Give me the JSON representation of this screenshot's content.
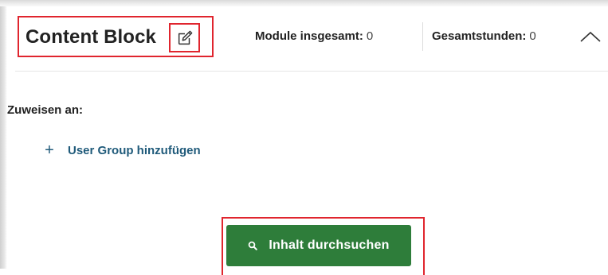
{
  "block": {
    "title": "Content Block",
    "edit_icon": "pencil-edit-icon",
    "modules_label": "Module insgesamt:",
    "modules_value": "0",
    "hours_label": "Gesamtstunden:",
    "hours_value": "0",
    "collapse_icon": "chevron-up-icon"
  },
  "assign": {
    "label": "Zuweisen an:",
    "add_icon": "plus-icon",
    "add_label": "User Group hinzufügen"
  },
  "search": {
    "icon": "search-icon",
    "label": "Inhalt durchsuchen"
  },
  "colors": {
    "highlight": "#e0252e",
    "primary_button": "#2e7d3a",
    "link": "#1f5a7a",
    "text": "#222222"
  }
}
